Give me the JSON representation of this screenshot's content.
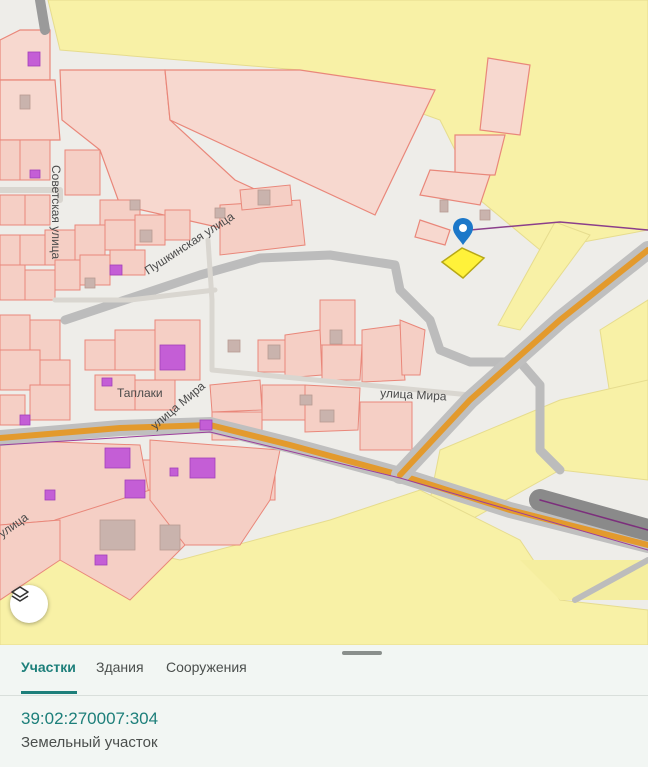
{
  "map": {
    "streets": {
      "sovetskaya": "Советская улица",
      "pushkinskaya": "Пушкинская улица",
      "mira_west": "улица Мира",
      "mira_east": "улица Мира",
      "locality": "Таплаки",
      "southwest_partial": "улица"
    },
    "colors": {
      "farmland": "#f8f1a6",
      "parcel_fill": "#f5cfc5",
      "parcel_stroke": "#e9877a",
      "building": "#c45ed6",
      "road": "#e39a2d",
      "selected_parcel": "#fff23a",
      "marker": "#1c78c9"
    },
    "icons": {
      "marker": "location-pin-icon",
      "layers": "layers-icon"
    }
  },
  "tabs": [
    {
      "label": "Участки",
      "active": true
    },
    {
      "label": "Здания",
      "active": false
    },
    {
      "label": "Сооружения",
      "active": false
    }
  ],
  "parcel": {
    "cadastral_number": "39:02:270007:304",
    "type": "Земельный участок"
  }
}
